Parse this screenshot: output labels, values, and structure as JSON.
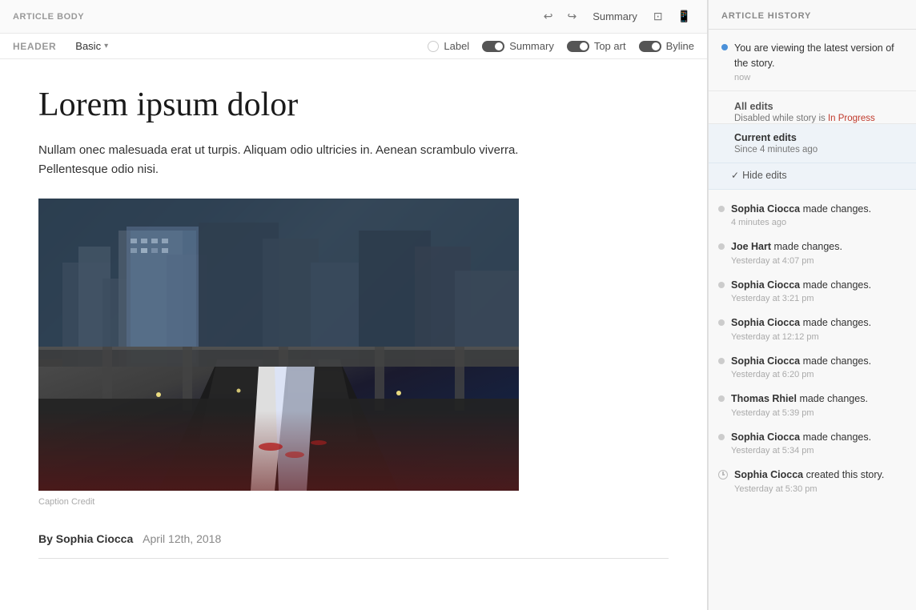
{
  "toolbar": {
    "section_label": "ARTICLE BODY",
    "summary_btn": "Summary",
    "undo_icon": "↩",
    "redo_icon": "↪"
  },
  "header_bar": {
    "label": "HEADER",
    "dropdown_value": "Basic",
    "toggles": [
      {
        "id": "label",
        "text": "Label",
        "state": "off"
      },
      {
        "id": "summary",
        "text": "Summary",
        "state": "on"
      },
      {
        "id": "top-art",
        "text": "Top art",
        "state": "on"
      },
      {
        "id": "byline",
        "text": "Byline",
        "state": "on"
      }
    ]
  },
  "article": {
    "title": "Lorem ipsum dolor",
    "body": "Nullam onec malesuada erat ut turpis. Aliquam odio ultricies in. Aenean scrambulo viverra. Pellentesque odio nisi.",
    "image_caption": "Caption  Credit",
    "byline_author": "By Sophia Ciocca",
    "byline_date": "April 12th, 2018"
  },
  "sidebar": {
    "title": "ARTICLE HISTORY",
    "current_user": {
      "text": "You are viewing the latest version of the story.",
      "time": "now"
    },
    "all_edits": {
      "title": "All edits",
      "status": "Disabled while story is",
      "status_highlight": "In Progress"
    },
    "current_edits": {
      "title": "Current edits",
      "time": "Since 4 minutes ago"
    },
    "hide_edits_btn": "Hide edits",
    "history": [
      {
        "author": "Sophia Ciocca",
        "action": " made changes.",
        "time": "4 minutes ago",
        "dot_type": "gray"
      },
      {
        "author": "Joe Hart",
        "action": " made changes.",
        "time": "Yesterday at 4:07 pm",
        "dot_type": "gray"
      },
      {
        "author": "Sophia Ciocca",
        "action": " made changes.",
        "time": "Yesterday at 3:21 pm",
        "dot_type": "gray"
      },
      {
        "author": "Sophia Ciocca",
        "action": " made changes.",
        "time": "Yesterday at 12:12 pm",
        "dot_type": "gray"
      },
      {
        "author": "Sophia Ciocca",
        "action": " made changes.",
        "time": "Yesterday at 6:20 pm",
        "dot_type": "gray"
      },
      {
        "author": "Thomas Rhiel",
        "action": " made changes.",
        "time": "Yesterday at 5:39 pm",
        "dot_type": "gray"
      },
      {
        "author": "Sophia Ciocca",
        "action": " made changes.",
        "time": "Yesterday at 5:34 pm",
        "dot_type": "gray"
      },
      {
        "author": "Sophia Ciocca",
        "action": " created this story.",
        "time": "Yesterday at 5:30 pm",
        "dot_type": "clock"
      }
    ]
  }
}
